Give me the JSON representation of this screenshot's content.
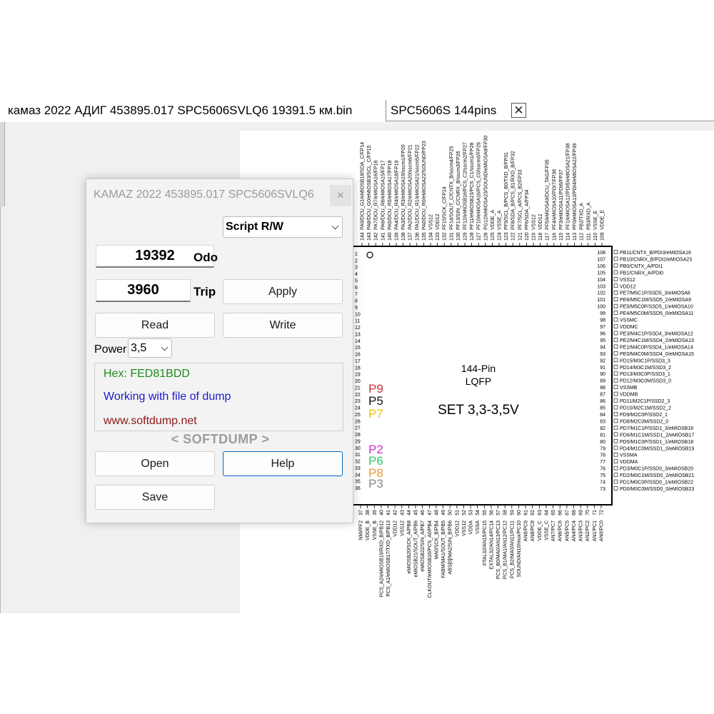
{
  "tabs": [
    {
      "label": "камаз 2022 АДИГ 453895.017  SPC5606SVLQ6  19391.5 км.bin"
    },
    {
      "label": "SPC5606S 144pins"
    }
  ],
  "dialog": {
    "title": "KAMAZ 2022 453895.017 SPC5606SVLQ6",
    "mode_select": "Script R/W",
    "odo_value": "19392",
    "odo_label": "Odo",
    "trip_value": "3960",
    "trip_label": "Trip",
    "apply": "Apply",
    "read": "Read",
    "write": "Write",
    "power_label": "Power",
    "power_value": "3,5",
    "info_hex": "Hex: FED81BDD",
    "info_status": "Working with file of dump",
    "info_site": "www.softdump.net",
    "brand": "< SOFTDUMP >",
    "open": "Open",
    "help": "Help",
    "save": "Save"
  },
  "chip": {
    "package_line1": "144-Pin",
    "package_line2": "LQFP",
    "set_text": "SET 3,3-3,5V",
    "labels": [
      {
        "text": "P9",
        "color": "#c8383a"
      },
      {
        "text": "P5",
        "color": "#111111"
      },
      {
        "text": "P7",
        "color": "#f2c200"
      },
      {
        "text": "P2",
        "color": "#cc33cc"
      },
      {
        "text": "P6",
        "color": "#33cc66"
      },
      {
        "text": "P8",
        "color": "#ee9933"
      },
      {
        "text": "P3",
        "color": "#888888"
      }
    ],
    "top_pins": [
      {
        "n": 144,
        "name": "PA9/DCU_G1/eMIOSB18/SDA_C/FP14"
      },
      {
        "n": 143,
        "name": "PA8/DCU_G0/eMIOSB3/SCL_C/FP15"
      },
      {
        "n": 142,
        "name": "PA7/DCU_R7/eMIOSA16/FP16"
      },
      {
        "n": 141,
        "name": "PA6/DCU_R6/eMIOSA15/FP17"
      },
      {
        "n": 140,
        "name": "PA5/DCU_R5/eMIOSA17/FP18"
      },
      {
        "n": 139,
        "name": "PA4/DCU_R4/eMIOSA18/FP19"
      },
      {
        "n": 138,
        "name": "PA3/DCU_R3/eMIOSA19/sscm1/FP20"
      },
      {
        "n": 137,
        "name": "PA2/DCU_R2/eMIOSA20/sscm6/FP21"
      },
      {
        "n": 136,
        "name": "PA1/DCU_R1/eMIOSA21/sscm5/FP22"
      },
      {
        "n": 135,
        "name": "PA0/DCU_R0/eMIOSA22/SOUND/FP23"
      },
      {
        "n": 134,
        "name": "VSS12"
      },
      {
        "n": 133,
        "name": "VDD12"
      },
      {
        "n": 132,
        "name": "PF15/SCK_C/FP24"
      },
      {
        "n": 131,
        "name": "PF14/SOUT_C/CNTX_B/sscm4/FP25"
      },
      {
        "n": 130,
        "name": "PF13/SIN_C/CNRX_B/sscm3/FP26"
      },
      {
        "n": 129,
        "name": "PF12/eMIOSB16/PCS_C2/sscm2/FP27"
      },
      {
        "n": 128,
        "name": "PF11/eMIOSB23/PCS_C1/sscm1/FP28"
      },
      {
        "n": 127,
        "name": "PF10/eMIOSA16/PCS_C0/sscm0/FP29"
      },
      {
        "n": 126,
        "name": "PG12/eMIOSA23/SOUND/eMIOSA8/FP30"
      },
      {
        "n": 125,
        "name": "VDDE_A"
      },
      {
        "n": 124,
        "name": "VSSE_A"
      },
      {
        "n": 123,
        "name": "PF9/SCL_B/PCS_B0/TXD_B/FP31"
      },
      {
        "n": 122,
        "name": "PF8/SDA_B/PCS_B1/RXD_B/FP32"
      },
      {
        "n": 121,
        "name": "PF7/SCL_A/PCS_B2/FP33"
      },
      {
        "n": 120,
        "name": "PF6/SDA_A/FP34"
      },
      {
        "n": 119,
        "name": "VSS12"
      },
      {
        "n": 118,
        "name": "VDD12"
      },
      {
        "n": 117,
        "name": "PF5/eMIOSA9/DCU_TAG/FP35"
      },
      {
        "n": 116,
        "name": "PF4/eMIOSA10/PDI7/FP36"
      },
      {
        "n": 115,
        "name": "PF3/eMIOSA11/PDI6/FP37"
      },
      {
        "n": 114,
        "name": "PF1/eMIOSA12/PDI5/eMIOSA21/FP38"
      },
      {
        "n": 113,
        "name": "PF0/eMIOSA13/PDI4/eMIOSA22/FP39"
      },
      {
        "n": 112,
        "name": "PB2/TXD_A"
      },
      {
        "n": 111,
        "name": "PB3/RXD_A"
      },
      {
        "n": 110,
        "name": "VSSE_E"
      },
      {
        "n": 109,
        "name": "VDDE_E"
      }
    ],
    "right_pins": [
      {
        "n": 108,
        "name": "PB11/CNTX_B/PDI3/eMIOSA16"
      },
      {
        "n": 107,
        "name": "PB10/CNRX_B/PDI2/eMIOSA23"
      },
      {
        "n": 106,
        "name": "PB0/CNTX_A/PDI1"
      },
      {
        "n": 105,
        "name": "PB1/CNRX_A/PDI0"
      },
      {
        "n": 104,
        "name": "VSS12"
      },
      {
        "n": 103,
        "name": "VDD12"
      },
      {
        "n": 102,
        "name": "PE7/M5C1P/SSD5_3/eMIOSA8"
      },
      {
        "n": 101,
        "name": "PE6/M5C1M/SSD5_2/eMIOSA9"
      },
      {
        "n": 100,
        "name": "PE5/M5C0P/SSD5_1/eMIOSA10"
      },
      {
        "n": 99,
        "name": "PE4/M5C0M/SSD5_0/eMIOSA11"
      },
      {
        "n": 98,
        "name": "VSSMC"
      },
      {
        "n": 97,
        "name": "VDDMC"
      },
      {
        "n": 96,
        "name": "PE3/M4C1P/SSD4_3/eMIOSA12"
      },
      {
        "n": 95,
        "name": "PE2/M4C1M/SSD4_2/eMIOSA13"
      },
      {
        "n": 94,
        "name": "PE1/M4C0P/SSD4_1/eMIOSA14"
      },
      {
        "n": 93,
        "name": "PE0/M4C0M/SSD4_0/eMIOSA15"
      },
      {
        "n": 92,
        "name": "PD15/M3C1P/SSD3_3"
      },
      {
        "n": 91,
        "name": "PD14/M3C1M/SSD3_2"
      },
      {
        "n": 90,
        "name": "PD13/M3C0P/SSD3_1"
      },
      {
        "n": 89,
        "name": "PD12/M3C0M/SSD3_0"
      },
      {
        "n": 88,
        "name": "VSSMB"
      },
      {
        "n": 87,
        "name": "VDDMB"
      },
      {
        "n": 86,
        "name": "PD11/M2C1P/SSD2_3"
      },
      {
        "n": 85,
        "name": "PD10/M2C1M/SSD2_2"
      },
      {
        "n": 84,
        "name": "PD9/M2C0P/SSD2_1"
      },
      {
        "n": 83,
        "name": "PD8/M2C0M/SSD2_0"
      },
      {
        "n": 82,
        "name": "PD7/M1C1P/SSD1_3/eMIOSB16"
      },
      {
        "n": 81,
        "name": "PD6/M1C1M/SSD1_2/eMIOSB17"
      },
      {
        "n": 80,
        "name": "PD5/M1C0P/SSD1_1/eMIOSB18"
      },
      {
        "n": 79,
        "name": "PD4/M1C0M/SSD1_0/eMIOSB19"
      },
      {
        "n": 78,
        "name": "VSSMA"
      },
      {
        "n": 77,
        "name": "VDDMA"
      },
      {
        "n": 76,
        "name": "PD3/M0C1P/SSD0_3/eMIOSB20"
      },
      {
        "n": 75,
        "name": "PD2/M0C1M/SSD0_2/eMIOSB21"
      },
      {
        "n": 74,
        "name": "PD1/M0C0P/SSD0_1/eMIOSB22"
      },
      {
        "n": 73,
        "name": "PD0/M0C0M/SSD0_0/eMIOSB23"
      }
    ],
    "bottom_pins": [
      {
        "n": 37,
        "name": "NMI/PF2"
      },
      {
        "n": 38,
        "name": "VDDE_B"
      },
      {
        "n": 39,
        "name": "VSSE_B"
      },
      {
        "n": 40,
        "name": "PCS_A2/eMIOSB19/RXD_B/PB12"
      },
      {
        "n": 41,
        "name": "PCS_A1/eMIOSB17/TXD_B/PB13"
      },
      {
        "n": 42,
        "name": "VDD12"
      },
      {
        "n": 43,
        "name": "VSS12"
      },
      {
        "n": 44,
        "name": "eMIOSB20/SCK_A/PB8"
      },
      {
        "n": 45,
        "name": "eMIOSB21/SOUT_A/PB6"
      },
      {
        "n": 46,
        "name": "eMIOSB22/SIN_A/PB7"
      },
      {
        "n": 47,
        "name": "CLKOUT/eMIOSB16/PCS_A0/PB4"
      },
      {
        "n": 48,
        "name": "MA0/SCK_B/PB4"
      },
      {
        "n": 49,
        "name": "FABM/MA1/SOUT_B/PB5"
      },
      {
        "n": 50,
        "name": "ABS[0]/MA2/SIN_B/PB6"
      },
      {
        "n": 51,
        "name": "VDD12"
      },
      {
        "n": 52,
        "name": "VSS12"
      },
      {
        "n": 53,
        "name": "VDDA"
      },
      {
        "n": 54,
        "name": "VSSA"
      },
      {
        "n": 55,
        "name": "XTAL32/AN15/PC15"
      },
      {
        "n": 56,
        "name": "EXTAL32/AN14/PC14"
      },
      {
        "n": 57,
        "name": "PCS_B0/MA0/AN13/PC13"
      },
      {
        "n": 58,
        "name": "PCS_B1/MA1/AN12/PC12"
      },
      {
        "n": 59,
        "name": "PCS_B2/MA0/AN11/PC11"
      },
      {
        "n": 60,
        "name": "SOUND/AN10/mux/PC10"
      },
      {
        "n": 61,
        "name": "AN9/PC9"
      },
      {
        "n": 62,
        "name": "AN8/PC8"
      },
      {
        "n": 63,
        "name": "VDDE_C"
      },
      {
        "n": 64,
        "name": "VSSE_C"
      },
      {
        "n": 65,
        "name": "AN7/PC7"
      },
      {
        "n": 66,
        "name": "AN6/PC6"
      },
      {
        "n": 67,
        "name": "AN5/PC5"
      },
      {
        "n": 68,
        "name": "AN4/PC4"
      },
      {
        "n": 69,
        "name": "AN3/PC3"
      },
      {
        "n": 70,
        "name": "AN2/PC2"
      },
      {
        "n": 71,
        "name": "AN1/PC1"
      },
      {
        "n": 72,
        "name": "AN0/PC0"
      }
    ]
  }
}
